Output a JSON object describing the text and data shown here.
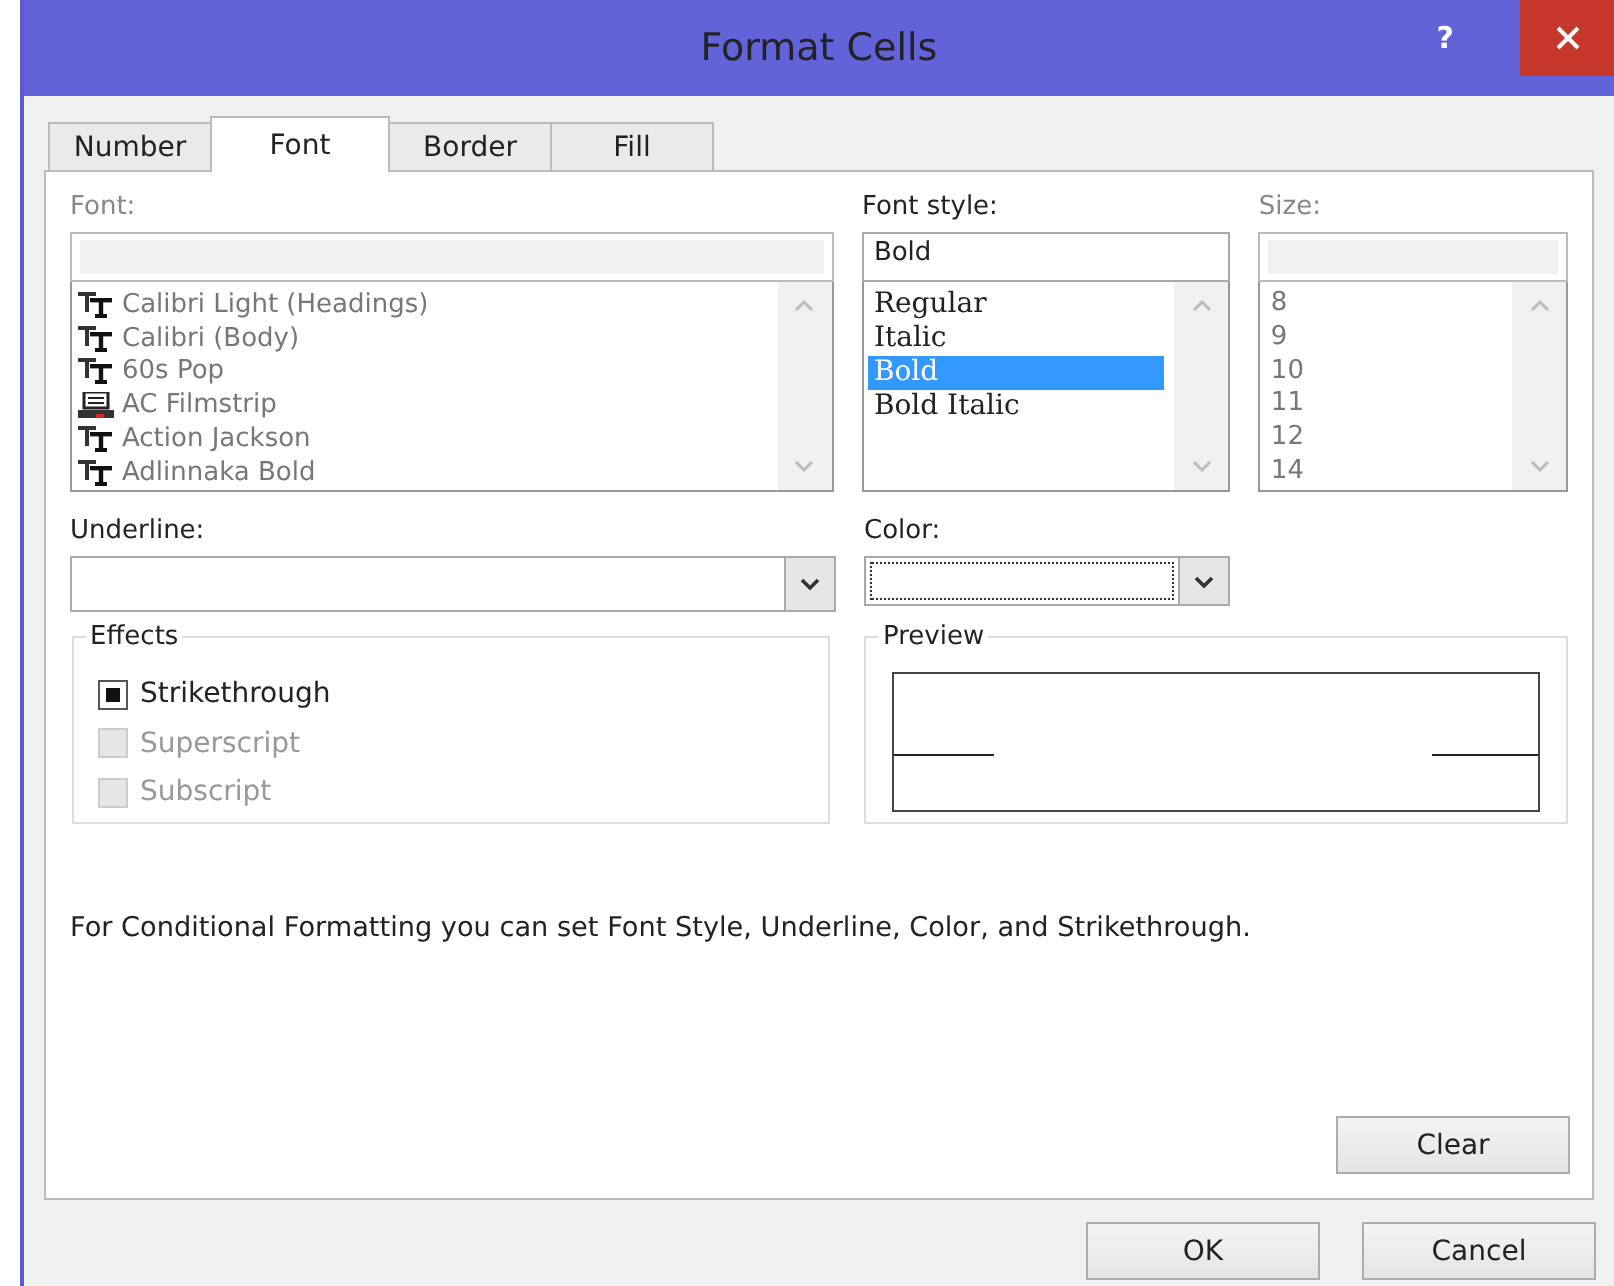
{
  "window": {
    "title": "Format Cells",
    "help": "?"
  },
  "tabs": [
    {
      "label": "Number",
      "selected": false
    },
    {
      "label": "Font",
      "selected": true
    },
    {
      "label": "Border",
      "selected": false
    },
    {
      "label": "Fill",
      "selected": false
    }
  ],
  "font": {
    "label": "Font:",
    "items": [
      {
        "name": "Calibri Light (Headings)",
        "kind": "truetype"
      },
      {
        "name": "Calibri (Body)",
        "kind": "truetype"
      },
      {
        "name": "60s Pop",
        "kind": "truetype"
      },
      {
        "name": "AC Filmstrip",
        "kind": "printer"
      },
      {
        "name": "Action Jackson",
        "kind": "truetype"
      },
      {
        "name": "Adlinnaka Bold",
        "kind": "truetype"
      }
    ]
  },
  "font_style": {
    "label": "Font style:",
    "value": "Bold",
    "items": [
      {
        "name": "Regular",
        "selected": false
      },
      {
        "name": "Italic",
        "selected": false
      },
      {
        "name": "Bold",
        "selected": true
      },
      {
        "name": "Bold Italic",
        "selected": false
      }
    ]
  },
  "size": {
    "label": "Size:",
    "items": [
      "8",
      "9",
      "10",
      "11",
      "12",
      "14"
    ]
  },
  "underline": {
    "label": "Underline:"
  },
  "color": {
    "label": "Color:"
  },
  "effects": {
    "title": "Effects",
    "items": [
      {
        "label": "Strikethrough",
        "mixed": true,
        "disabled": false
      },
      {
        "label": "Superscript",
        "mixed": false,
        "disabled": true
      },
      {
        "label": "Subscript",
        "mixed": false,
        "disabled": true
      }
    ]
  },
  "preview": {
    "title": "Preview"
  },
  "note": "For Conditional Formatting you can set Font Style, Underline, Color, and Strikethrough.",
  "buttons": {
    "clear": "Clear",
    "ok": "OK",
    "cancel": "Cancel"
  }
}
